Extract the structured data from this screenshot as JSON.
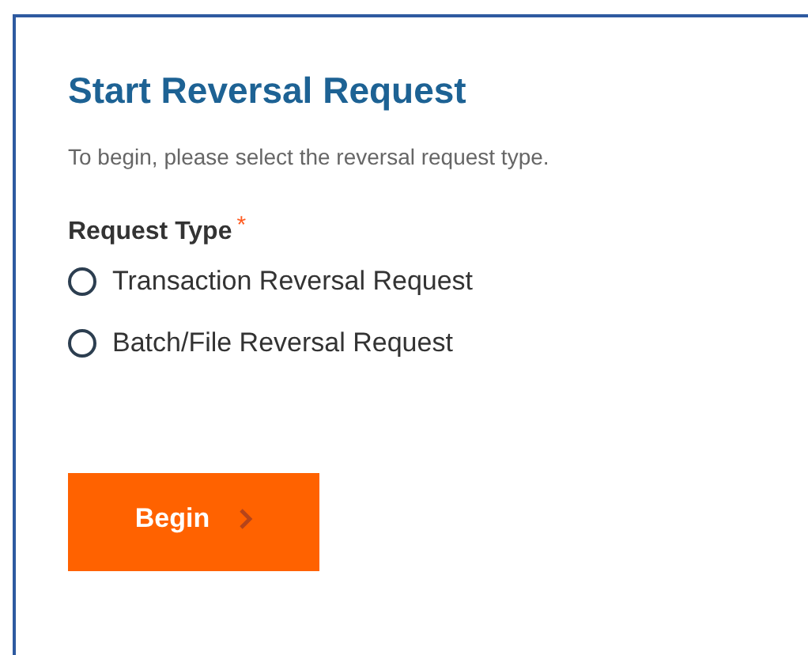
{
  "title": "Start Reversal Request",
  "intro": "To begin, please select the reversal request type.",
  "field": {
    "label": "Request Type",
    "required_mark": "*",
    "options": [
      {
        "label": "Transaction Reversal Request",
        "selected": false
      },
      {
        "label": "Batch/File Reversal Request",
        "selected": false
      }
    ]
  },
  "button": {
    "label": "Begin"
  }
}
